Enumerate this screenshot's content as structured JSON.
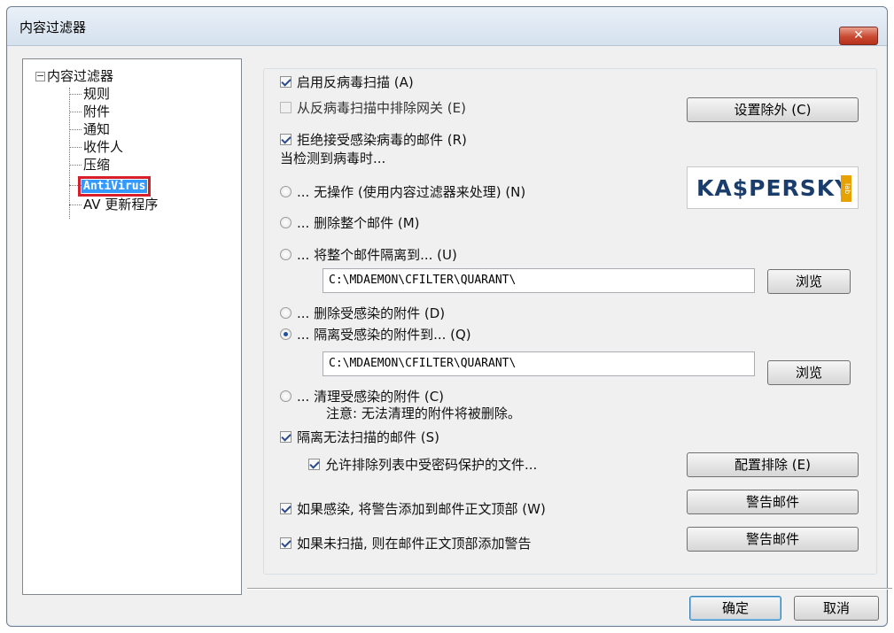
{
  "window": {
    "title": "内容过滤器",
    "close_label": "✕"
  },
  "tree": {
    "root": "内容过滤器",
    "toggle": "−",
    "items": [
      "规则",
      "附件",
      "通知",
      "收件人",
      "压缩",
      "AntiVirus",
      "AV 更新程序"
    ],
    "selected": "AntiVirus"
  },
  "antivirus": {
    "enable_scan": {
      "label": "启用反病毒扫描 (A)",
      "checked": true
    },
    "exclude_gateways": {
      "label": "从反病毒扫描中排除网关 (E)",
      "checked": false,
      "enabled": false
    },
    "exclusions_button": "设置除外 (C)",
    "reject_infected": {
      "label": "拒绝接受感染病毒的邮件 (R)",
      "checked": true
    },
    "when_detected": "当检测到病毒时...",
    "logo": {
      "text": "KA$PERSKY",
      "badge": "lab"
    },
    "actions": [
      {
        "label": "... 无操作 (使用内容过滤器来处理) (N)",
        "selected": false
      },
      {
        "label": "... 删除整个邮件 (M)",
        "selected": false
      },
      {
        "label": "... 将整个邮件隔离到... (U)",
        "selected": false
      },
      {
        "label": "... 删除受感染的附件 (D)",
        "selected": false
      },
      {
        "label": "... 隔离受感染的附件到... (Q)",
        "selected": true
      },
      {
        "label": "... 清理受感染的附件 (C)",
        "selected": false
      }
    ],
    "quarantine_path_1": "C:\\MDAEMON\\CFILTER\\QUARANT\\",
    "quarantine_path_2": "C:\\MDAEMON\\CFILTER\\QUARANT\\",
    "browse_label": "浏览",
    "clean_note": "注意: 无法清理的附件将被删除。",
    "quarantine_unscannable": {
      "label": "隔离无法扫描的邮件 (S)",
      "checked": true
    },
    "allow_password_protected": {
      "label": "允许排除列表中受密码保护的文件...",
      "checked": true
    },
    "config_exclusions_button": "配置排除 (E)",
    "warn_infected": {
      "label": "如果感染, 将警告添加到邮件正文顶部 (W)",
      "checked": true
    },
    "warn_unscanned": {
      "label": "如果未扫描, 则在邮件正文顶部添加警告",
      "checked": true
    },
    "warning_message_button": "警告邮件"
  },
  "footer": {
    "ok": "确定",
    "cancel": "取消"
  }
}
